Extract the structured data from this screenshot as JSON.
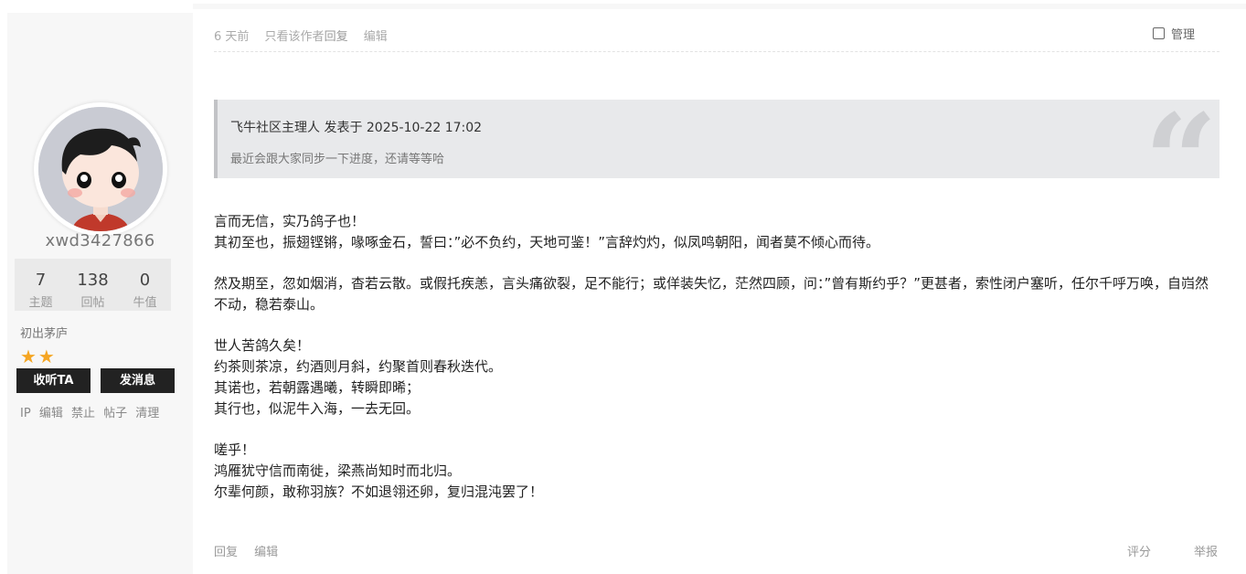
{
  "user": {
    "name": "xwd3427866",
    "stats": [
      {
        "value": "7",
        "label": "主题"
      },
      {
        "value": "138",
        "label": "回帖"
      },
      {
        "value": "0",
        "label": "牛值"
      }
    ],
    "rank": "初出茅庐",
    "stars": "★★",
    "star_count": 2,
    "star_color": "#f5a623",
    "follow_label": "收听TA",
    "message_label": "发消息",
    "admin_links": [
      "IP",
      "编辑",
      "禁止",
      "帖子",
      "清理"
    ]
  },
  "post": {
    "time": "6 天前",
    "only_author": "只看该作者",
    "reply": "回复",
    "edit": "编辑",
    "manage": "管理",
    "quote": {
      "header": "飞牛社区主理人 发表于 2025-10-22 17:02",
      "body": "最近会跟大家同步一下进度，还请等等哈",
      "mark": "“"
    },
    "paragraphs": [
      [
        "言而无信，实乃鸽子也！",
        "其初至也，振翅铿锵，喙啄金石，誓曰：”必不负约，天地可鉴！”言辞灼灼，似凤鸣朝阳，闻者莫不倾心而待。"
      ],
      [
        "然及期至，忽如烟消，杳若云散。或假托疾恙，言头痛欲裂，足不能行；或佯装失忆，茫然四顾，问：”曾有斯约乎？”更甚者，索性闭户塞听，任尔千呼万唤，自岿然不动，稳若泰山。"
      ],
      [
        "世人苦鸽久矣！",
        "约茶则茶凉，约酒则月斜，约聚首则春秋迭代。",
        "其诺也，若朝露遇曦，转瞬即晞；",
        "其行也，似泥牛入海，一去无回。"
      ],
      [
        "嗟乎！",
        "鸿雁犹守信而南徙，梁燕尚知时而北归。",
        "尔辈何颜，敢称羽族？不如退翎还卵，复归混沌罢了！"
      ]
    ],
    "footer": {
      "reply": "回复",
      "edit": "编辑",
      "rate": "评分",
      "report": "举报"
    }
  }
}
